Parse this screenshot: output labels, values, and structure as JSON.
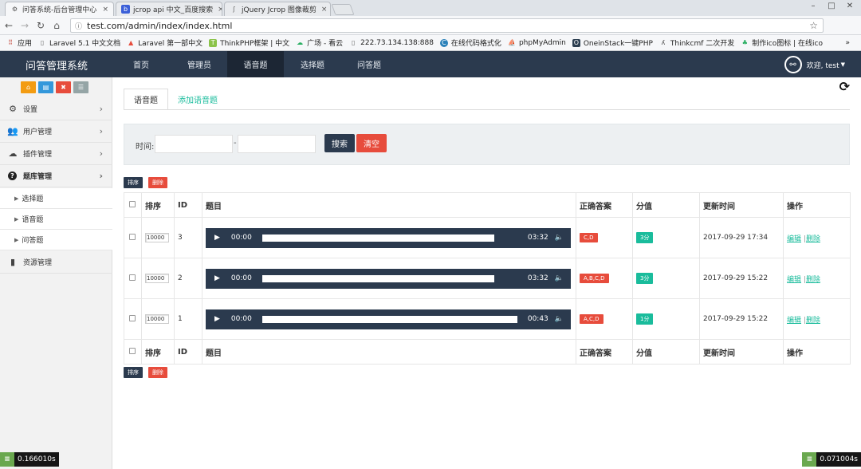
{
  "browser": {
    "tabs": [
      {
        "title": "问答系统-后台管理中心",
        "close": "×"
      },
      {
        "title": "jcrop api 中文_百度搜索",
        "close": "×"
      },
      {
        "title": "jQuery Jcrop 图像裁剪",
        "close": "×"
      }
    ],
    "url": "test.com/admin/index/index.html",
    "bookmarks": [
      "应用",
      "Laravel 5.1 中文文档",
      "Laravel 第一部中文",
      "ThinkPHP框架 | 中文",
      "广场 - 看云",
      "222.73.134.138:888",
      "在线代码格式化",
      "phpMyAdmin",
      "OneinStack一键PHP",
      "Thinkcmf 二次开发",
      "制作ico图标 | 在线ico"
    ],
    "more": "»"
  },
  "app": {
    "brand": "问答管理系统",
    "nav": [
      "首页",
      "管理员",
      "语音题",
      "选择题",
      "问答题"
    ],
    "user": "欢迎, test"
  },
  "sidebar": {
    "menu": [
      {
        "label": "设置",
        "icon": "gear-icon"
      },
      {
        "label": "用户管理",
        "icon": "users-icon"
      },
      {
        "label": "插件管理",
        "icon": "cloud-icon"
      },
      {
        "label": "题库管理",
        "icon": "question-icon"
      }
    ],
    "submenu": [
      "选择题",
      "语音题",
      "问答题"
    ],
    "resource": {
      "label": "资源管理",
      "icon": "file-icon"
    }
  },
  "content": {
    "tabs": [
      "语音题",
      "添加语音题"
    ],
    "search": {
      "time_label": "时间:",
      "dash": "-",
      "search_btn": "搜索",
      "clear_btn": "清空"
    },
    "sort_btn": "排序",
    "delete_btn": "删除",
    "columns": [
      "排序",
      "ID",
      "题目",
      "正确答案",
      "分值",
      "更新时间",
      "操作"
    ],
    "rows": [
      {
        "sort": "10000",
        "id": "3",
        "current": "00:00",
        "duration": "03:32",
        "answer": "C,D",
        "score": "3分",
        "updated": "2017-09-29 17:34",
        "edit": "编辑",
        "del": "删除"
      },
      {
        "sort": "10000",
        "id": "2",
        "current": "00:00",
        "duration": "03:32",
        "answer": "A,B,C,D",
        "score": "3分",
        "updated": "2017-09-29 15:22",
        "edit": "编辑",
        "del": "删除"
      },
      {
        "sort": "10000",
        "id": "1",
        "current": "00:00",
        "duration": "00:43",
        "answer": "A,C,D",
        "score": "1分",
        "updated": "2017-09-29 15:22",
        "edit": "编辑",
        "del": "删除"
      }
    ]
  },
  "debug": {
    "left_time": "0.166010s",
    "right_time": "0.071004s"
  },
  "colors": {
    "navy": "#2b3a4e",
    "teal": "#1abc9c",
    "red": "#e74c3c",
    "orange": "#f39c12",
    "blue": "#3498db"
  }
}
